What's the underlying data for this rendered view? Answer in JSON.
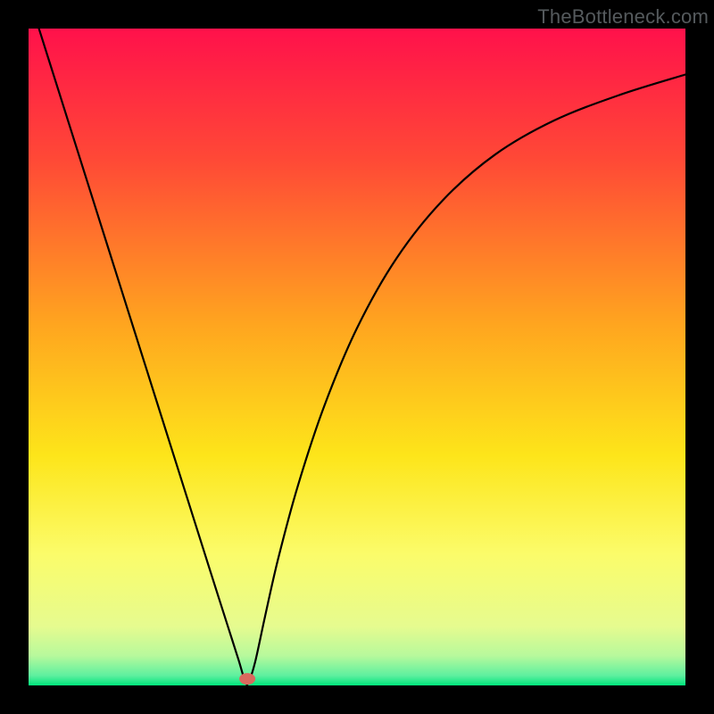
{
  "watermark": "TheBottleneck.com",
  "chart_data": {
    "type": "line",
    "title": "",
    "xlabel": "",
    "ylabel": "",
    "xlim": [
      0,
      100
    ],
    "ylim": [
      0,
      100
    ],
    "grid": false,
    "legend": false,
    "background_gradient": {
      "stops": [
        {
          "pos": 0.0,
          "color": "#ff114b"
        },
        {
          "pos": 0.2,
          "color": "#ff4936"
        },
        {
          "pos": 0.45,
          "color": "#ffa51f"
        },
        {
          "pos": 0.65,
          "color": "#fde51a"
        },
        {
          "pos": 0.8,
          "color": "#fbfc6a"
        },
        {
          "pos": 0.91,
          "color": "#e6fb8f"
        },
        {
          "pos": 0.955,
          "color": "#b7f99c"
        },
        {
          "pos": 0.985,
          "color": "#5ef09f"
        },
        {
          "pos": 1.0,
          "color": "#00e57c"
        }
      ]
    },
    "series": [
      {
        "name": "bottleneck-curve",
        "x": [
          0,
          3,
          6,
          9,
          12,
          15,
          18,
          21,
          24,
          27,
          29,
          30.5,
          32,
          33,
          33.5,
          34.5,
          36,
          38,
          41,
          45,
          50,
          56,
          63,
          71,
          80,
          90,
          100
        ],
        "y": [
          105,
          95.5,
          86,
          76.5,
          67,
          57.5,
          48,
          38.5,
          29,
          19.5,
          13.2,
          8.5,
          3.8,
          0.5,
          0.5,
          3.6,
          10.5,
          19.3,
          30.4,
          42.5,
          54.4,
          65.0,
          73.8,
          80.8,
          86.0,
          89.9,
          93.0
        ]
      }
    ],
    "marker": {
      "x": 33.3,
      "y": 1.0,
      "color": "#d96a5e"
    },
    "colors": {
      "curve": "#000000",
      "marker_fill": "#d96a5e",
      "frame": "#000000"
    }
  }
}
